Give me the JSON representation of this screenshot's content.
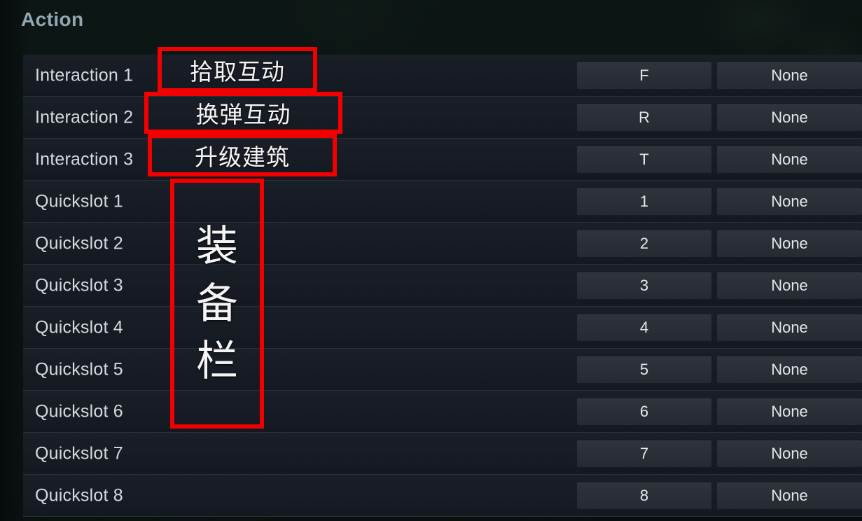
{
  "header": {
    "title": "Action"
  },
  "accent_colors": {
    "annotation_red": "#f20000",
    "header_text": "#93a7b2",
    "row_background": "#171b23",
    "bind_button": "#2a2f37",
    "page_background": "#0c1614"
  },
  "bindings": [
    {
      "action": "Interaction 1",
      "primary": "F",
      "secondary": "None"
    },
    {
      "action": "Interaction 2",
      "primary": "R",
      "secondary": "None"
    },
    {
      "action": "Interaction 3",
      "primary": "T",
      "secondary": "None"
    },
    {
      "action": "Quickslot 1",
      "primary": "1",
      "secondary": "None"
    },
    {
      "action": "Quickslot 2",
      "primary": "2",
      "secondary": "None"
    },
    {
      "action": "Quickslot 3",
      "primary": "3",
      "secondary": "None"
    },
    {
      "action": "Quickslot 4",
      "primary": "4",
      "secondary": "None"
    },
    {
      "action": "Quickslot 5",
      "primary": "5",
      "secondary": "None"
    },
    {
      "action": "Quickslot 6",
      "primary": "6",
      "secondary": "None"
    },
    {
      "action": "Quickslot 7",
      "primary": "7",
      "secondary": "None"
    },
    {
      "action": "Quickslot 8",
      "primary": "8",
      "secondary": "None"
    }
  ],
  "annotations": [
    {
      "text": "拾取互动",
      "target": "Interaction 1"
    },
    {
      "text": "换弹互动",
      "target": "Interaction 2"
    },
    {
      "text": "升级建筑",
      "target": "Interaction 3"
    },
    {
      "chars": [
        "装",
        "备",
        "栏"
      ],
      "text": "装备栏",
      "target": "Quickslot 1-6"
    }
  ]
}
